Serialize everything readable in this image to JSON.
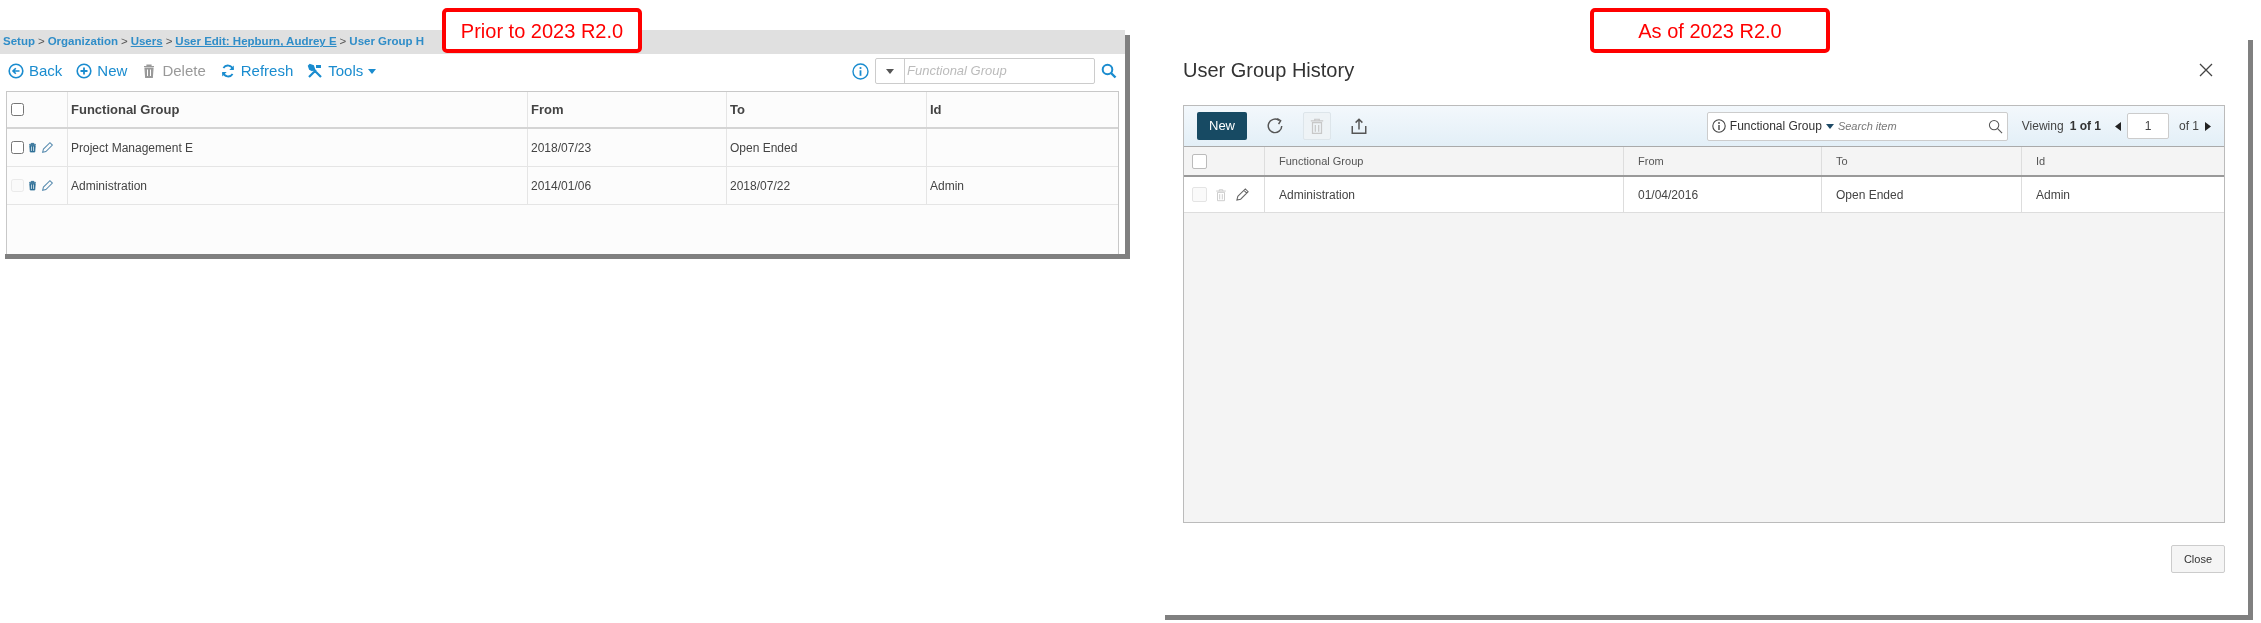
{
  "annotations": [
    {
      "text": "Prior to 2023 R2.0"
    },
    {
      "text": "As of 2023 R2.0"
    }
  ],
  "old_page": {
    "breadcrumb": {
      "separator": ">",
      "items": [
        {
          "label": "Setup",
          "link": false
        },
        {
          "label": "Organization",
          "link": false
        },
        {
          "label": "Users",
          "link": true
        },
        {
          "label": "User Edit: Hepburn, Audrey E",
          "link": true
        },
        {
          "label": "User Group H",
          "link": false
        }
      ]
    },
    "toolbar": [
      {
        "label": "Back",
        "disabled": false,
        "dropdown": false
      },
      {
        "label": "New",
        "disabled": false,
        "dropdown": false
      },
      {
        "label": "Delete",
        "disabled": true,
        "dropdown": false
      },
      {
        "label": "Refresh",
        "disabled": false,
        "dropdown": false
      },
      {
        "label": "Tools",
        "disabled": false,
        "dropdown": true
      }
    ],
    "search": {
      "placeholder": "Functional Group"
    },
    "table": {
      "select_all_checked": false,
      "columns": [
        "Functional Group",
        "From",
        "To",
        "Id"
      ],
      "rows": [
        {
          "disabled": false,
          "functional_group": "Project Management E",
          "from": "2018/07/23",
          "to": "Open Ended"
        },
        {
          "disabled": true,
          "functional_group": "Administration",
          "from": "2014/01/06",
          "to": "2018/07/22",
          "id": "Admin"
        }
      ]
    }
  },
  "dialog": {
    "title": "User Group History",
    "toolbar": {
      "new_button": "New",
      "icons": [
        {
          "disabled": false
        },
        {
          "disabled": true
        },
        {
          "disabled": false
        }
      ]
    },
    "search": {
      "field": "Functional Group",
      "placeholder": "Search item"
    },
    "pager": {
      "viewing_label": "Viewing",
      "viewing_count": "1 of 1",
      "page": "1",
      "total": "of 1"
    },
    "table": {
      "select_all_checked": false,
      "columns": [
        "Functional Group",
        "From",
        "To",
        "Id"
      ],
      "rows": [
        {
          "disabled": true,
          "functional_group": "Administration",
          "from": "01/04/2016",
          "to": "Open Ended",
          "id": "Admin"
        }
      ]
    },
    "footer_button": "Close"
  }
}
